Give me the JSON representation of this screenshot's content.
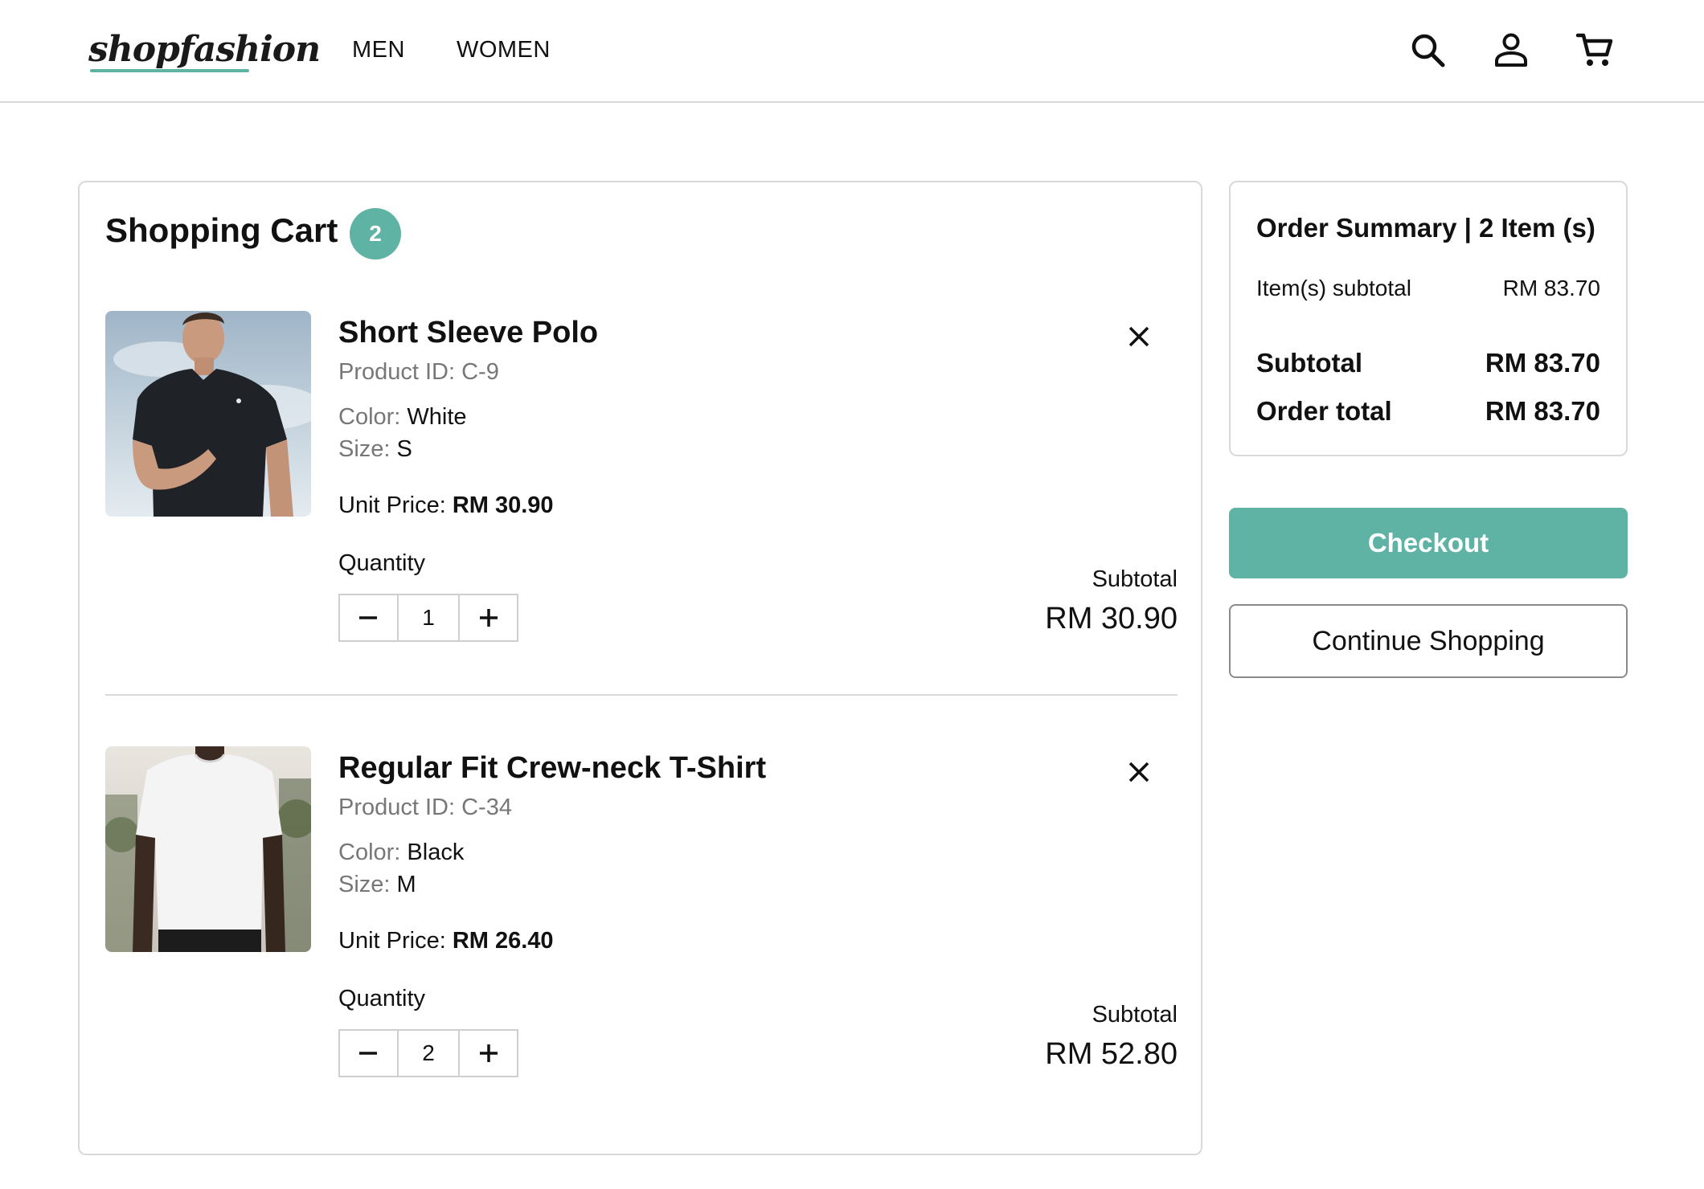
{
  "header": {
    "logo": "shopfashion",
    "nav": [
      "MEN",
      "WOMEN"
    ],
    "icons": [
      "search-icon",
      "user-icon",
      "cart-icon"
    ]
  },
  "cart": {
    "title": "Shopping Cart",
    "count": "2",
    "items": [
      {
        "name": "Short Sleeve Polo",
        "product_id": "Product ID: C-9",
        "color_label": "Color:",
        "color_value": "White",
        "size_label": "Size:",
        "size_value": "S",
        "unit_price_label": "Unit Price:",
        "unit_price": "RM 30.90",
        "quantity_label": "Quantity",
        "quantity": "1",
        "subtotal_label": "Subtotal",
        "subtotal": "RM 30.90"
      },
      {
        "name": "Regular Fit Crew-neck T-Shirt",
        "product_id": "Product ID: C-34",
        "color_label": "Color:",
        "color_value": "Black",
        "size_label": "Size:",
        "size_value": "M",
        "unit_price_label": "Unit Price:",
        "unit_price": "RM 26.40",
        "quantity_label": "Quantity",
        "quantity": "2",
        "subtotal_label": "Subtotal",
        "subtotal": "RM 52.80"
      }
    ]
  },
  "summary": {
    "title": "Order Summary | 2 Item (s)",
    "items_subtotal_label": "Item(s) subtotal",
    "items_subtotal": "RM 83.70",
    "subtotal_label": "Subtotal",
    "subtotal": "RM 83.70",
    "order_total_label": "Order total",
    "order_total": "RM 83.70"
  },
  "actions": {
    "checkout": "Checkout",
    "continue": "Continue Shopping"
  },
  "colors": {
    "accent": "#5fb3a4",
    "border": "#d9d9d9",
    "muted_text": "#777777"
  }
}
